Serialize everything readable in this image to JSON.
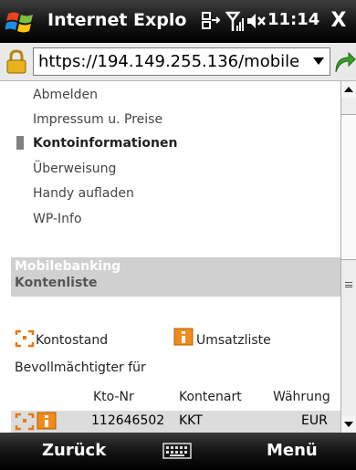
{
  "titlebar": {
    "title": "Internet Explo",
    "time": "11:14",
    "close_label": "X",
    "icons": [
      "windows-logo",
      "sync-icon",
      "signal-icon",
      "speaker-muted-icon"
    ]
  },
  "address": {
    "url": "https://194.149.255.136/mobile"
  },
  "menu": {
    "items": [
      {
        "label": "Abmelden"
      },
      {
        "label": "Impressum u. Preise"
      },
      {
        "label": "Kontoinformationen",
        "active": true
      },
      {
        "label": "Überweisung"
      },
      {
        "label": "Handy aufladen"
      },
      {
        "label": "WP-Info"
      }
    ]
  },
  "panel": {
    "line1": "Mobilebanking",
    "line2": "Kontenliste"
  },
  "links": {
    "kontostand": "Kontostand",
    "umsatzliste": "Umsatzliste"
  },
  "section_label": "Bevollmächtigter für",
  "table": {
    "headers": [
      "Kto-Nr",
      "Kontenart",
      "Währung"
    ],
    "rows": [
      {
        "kto_nr": "112646502",
        "kontenart": "KKT",
        "waehrung": "EUR"
      }
    ]
  },
  "softkeys": {
    "left": "Zurück",
    "right": "Menü"
  },
  "colors": {
    "accent_orange": "#e87a10",
    "panel_gray": "#d0d0d0"
  }
}
